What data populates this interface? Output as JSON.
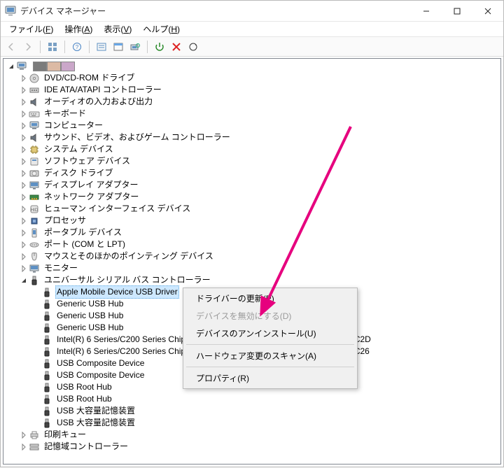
{
  "window": {
    "title": "デバイス マネージャー"
  },
  "win_buttons": {
    "min": "―",
    "max": "☐",
    "close": "✕"
  },
  "menubar": [
    {
      "label": "ファイル(F)",
      "key": "F"
    },
    {
      "label": "操作(A)",
      "key": "A"
    },
    {
      "label": "表示(V)",
      "key": "V"
    },
    {
      "label": "ヘルプ(H)",
      "key": "H"
    }
  ],
  "toolbar_icons": [
    "back-icon",
    "forward-icon",
    "sep",
    "view-icon",
    "sep",
    "help-icon",
    "sep",
    "details-icon",
    "props-icon",
    "scan-icon",
    "sep",
    "enable-icon",
    "uninstall-icon",
    "refresh-icon"
  ],
  "root": {
    "label": ""
  },
  "categories": [
    {
      "icon": "dvd",
      "label": "DVD/CD-ROM ドライブ"
    },
    {
      "icon": "ide",
      "label": "IDE ATA/ATAPI コントローラー"
    },
    {
      "icon": "audio",
      "label": "オーディオの入力および出力"
    },
    {
      "icon": "kbd",
      "label": "キーボード"
    },
    {
      "icon": "pc",
      "label": "コンピューター"
    },
    {
      "icon": "audio",
      "label": "サウンド、ビデオ、およびゲーム コントローラー"
    },
    {
      "icon": "chip",
      "label": "システム デバイス"
    },
    {
      "icon": "soft",
      "label": "ソフトウェア デバイス"
    },
    {
      "icon": "disk",
      "label": "ディスク ドライブ"
    },
    {
      "icon": "display",
      "label": "ディスプレイ アダプター"
    },
    {
      "icon": "net",
      "label": "ネットワーク アダプター"
    },
    {
      "icon": "hid",
      "label": "ヒューマン インターフェイス デバイス"
    },
    {
      "icon": "cpu",
      "label": "プロセッサ"
    },
    {
      "icon": "portable",
      "label": "ポータブル デバイス"
    },
    {
      "icon": "port",
      "label": "ポート (COM と LPT)"
    },
    {
      "icon": "mouse",
      "label": "マウスとそのほかのポインティング デバイス"
    },
    {
      "icon": "monitor",
      "label": "モニター"
    }
  ],
  "usb_category": {
    "icon": "usb",
    "label": "ユニバーサル シリアル バス コントローラー"
  },
  "usb_devices": [
    {
      "label": "Apple Mobile Device USB Driver",
      "selected": true
    },
    {
      "label": "Generic USB Hub"
    },
    {
      "label": "Generic USB Hub"
    },
    {
      "label": "Generic USB Hub"
    },
    {
      "label": "Intel(R) 6 Series/C200 Series Chipset Family USB Enhanced Host Controller - 1C2D"
    },
    {
      "label": "Intel(R) 6 Series/C200 Series Chipset Family USB Enhanced Host Controller - 1C26"
    },
    {
      "label": "USB Composite Device"
    },
    {
      "label": "USB Composite Device"
    },
    {
      "label": "USB Root Hub"
    },
    {
      "label": "USB Root Hub"
    },
    {
      "label": "USB 大容量記憶装置"
    },
    {
      "label": "USB 大容量記憶装置"
    }
  ],
  "post_categories": [
    {
      "icon": "print",
      "label": "印刷キュー"
    },
    {
      "icon": "storage",
      "label": "記憶域コントローラー"
    }
  ],
  "context_menu": [
    {
      "label": "ドライバーの更新(P)",
      "enabled": true
    },
    {
      "label": "デバイスを無効にする(D)",
      "enabled": false
    },
    {
      "label": "デバイスのアンインストール(U)",
      "enabled": true,
      "highlighted": true
    },
    {
      "sep": true
    },
    {
      "label": "ハードウェア変更のスキャン(A)",
      "enabled": true
    },
    {
      "sep": true
    },
    {
      "label": "プロパティ(R)",
      "enabled": true
    }
  ],
  "colors": {
    "highlight": "#e6007e",
    "selection": "#cde8ff"
  }
}
